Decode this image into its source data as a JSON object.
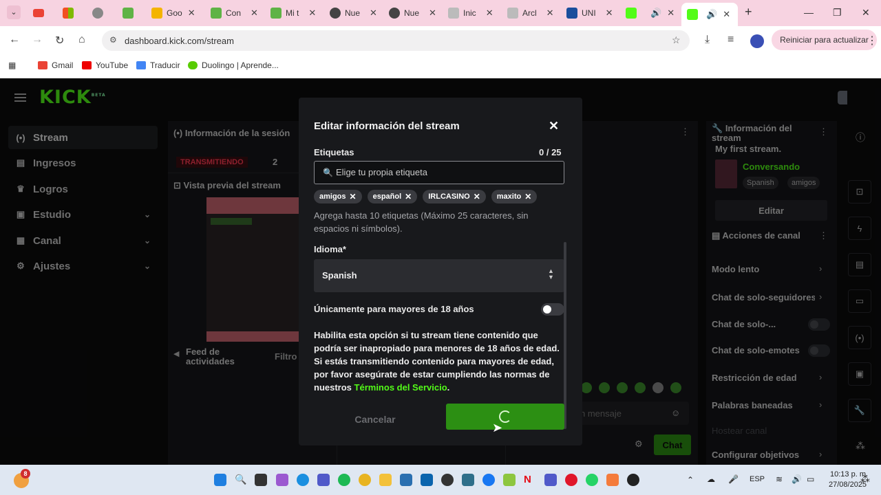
{
  "browser": {
    "tabs": [
      {
        "label": "",
        "color": "#d44"
      },
      {
        "label": "",
        "color": "#ea4335"
      },
      {
        "label": "",
        "color": "#f25022"
      },
      {
        "label": "",
        "color": "#888"
      },
      {
        "label": "",
        "color": "#5fb346"
      },
      {
        "label": "Goo",
        "color": "#f4b400"
      },
      {
        "label": "Con",
        "color": "#5fb346"
      },
      {
        "label": "Mi t",
        "color": "#5fb346"
      },
      {
        "label": "Nue",
        "color": "#444"
      },
      {
        "label": "Nue",
        "color": "#444"
      },
      {
        "label": "Inic",
        "color": "#999"
      },
      {
        "label": "Arcl",
        "color": "#999"
      },
      {
        "label": "UNI",
        "color": "#1a4e9c"
      },
      {
        "label": "",
        "color": "#53fc18"
      },
      {
        "label": "",
        "color": "#53fc18"
      }
    ],
    "url": "dashboard.kick.com/stream",
    "update_button": "Reiniciar para actualizar",
    "bookmarks": [
      "Gmail",
      "YouTube",
      "Traducir",
      "Duolingo | Aprende..."
    ]
  },
  "sidebar": {
    "logo": "KICK",
    "logo_badge": "BETA",
    "items": [
      {
        "label": "Stream",
        "icon": "broadcast-icon"
      },
      {
        "label": "Ingresos",
        "icon": "wallet-icon"
      },
      {
        "label": "Logros",
        "icon": "trophy-icon"
      },
      {
        "label": "Estudio",
        "icon": "studio-icon"
      },
      {
        "label": "Canal",
        "icon": "channel-icon"
      },
      {
        "label": "Ajustes",
        "icon": "gear-icon"
      }
    ]
  },
  "session": {
    "title": "Información de la sesión",
    "status": "TRANSMITIENDO",
    "count": "2",
    "preview_title": "Vista previa del stream",
    "feed_title": "Feed de actividades",
    "filter": "Filtro"
  },
  "chat": {
    "placeholder": "n mensaje",
    "button": "Chat"
  },
  "stream_info": {
    "title": "Información del stream",
    "stream_name": "My first stream.",
    "category": "Conversando",
    "tags": [
      "Spanish",
      "amigos"
    ],
    "edit": "Editar"
  },
  "channel_actions": {
    "title": "Acciones de canal",
    "items": [
      "Modo lento",
      "Chat de solo-seguidores",
      "Chat de solo-...",
      "Chat de solo-emotes",
      "Restricción de edad",
      "Palabras baneadas",
      "Hostear canal",
      "Configurar objetivos"
    ]
  },
  "modal": {
    "title": "Editar información del stream",
    "tags_label": "Etiquetas",
    "tags_counter": "0 / 25",
    "tag_placeholder": "Elige tu propia etiqueta",
    "tags": [
      "amigos",
      "español",
      "IRLCASINO",
      "maxito"
    ],
    "tags_hint": "Agrega hasta 10 etiquetas (Máximo 25 caracteres, sin espacios ni símbolos).",
    "language_label": "Idioma*",
    "language_value": "Spanish",
    "adult_label": "Únicamente para mayores de 18 años",
    "adult_desc": "Habilita esta opción si tu stream tiene contenido que podría ser inapropiado para menores de 18 años de edad. Si estás transmitiendo contenido para mayores de edad, por favor asegúrate de estar cumpliendo las normas de nuestros",
    "adult_link": "Términos del Servicio",
    "adult_end": ".",
    "cancel": "Cancelar"
  },
  "taskbar": {
    "badge": "8",
    "lang": "ESP",
    "time": "10:13 p. m.",
    "date": "27/08/2025"
  }
}
